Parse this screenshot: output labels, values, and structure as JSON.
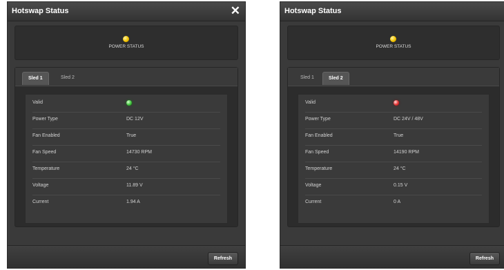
{
  "dialogs": [
    {
      "title": "Hotswap Status",
      "close_glyph": "✕",
      "power_status_label": "POWER STATUS",
      "power_status_color": "#f2c200",
      "tabs": [
        "Sled 1",
        "Sled 2"
      ],
      "active_tab": "Sled 1",
      "rows": [
        {
          "label": "Valid",
          "value": "",
          "led": "green"
        },
        {
          "label": "Power Type",
          "value": "DC 12V"
        },
        {
          "label": "Fan Enabled",
          "value": "True"
        },
        {
          "label": "Fan Speed",
          "value": "14730 RPM"
        },
        {
          "label": "Temperature",
          "value": "24 °C"
        },
        {
          "label": "Voltage",
          "value": "11.89 V"
        },
        {
          "label": "Current",
          "value": "1.94 A"
        }
      ],
      "refresh_label": "Refresh"
    },
    {
      "title": "Hotswap Status",
      "power_status_label": "POWER STATUS",
      "power_status_color": "#f2c200",
      "tabs": [
        "Sled 1",
        "Sled 2"
      ],
      "active_tab": "Sled 2",
      "rows": [
        {
          "label": "Valid",
          "value": "",
          "led": "red"
        },
        {
          "label": "Power Type",
          "value": "DC 24V / 48V"
        },
        {
          "label": "Fan Enabled",
          "value": "True"
        },
        {
          "label": "Fan Speed",
          "value": "14190 RPM"
        },
        {
          "label": "Temperature",
          "value": "24 °C"
        },
        {
          "label": "Voltage",
          "value": "0.15 V"
        },
        {
          "label": "Current",
          "value": "0 A"
        }
      ],
      "refresh_label": "Refresh"
    }
  ]
}
